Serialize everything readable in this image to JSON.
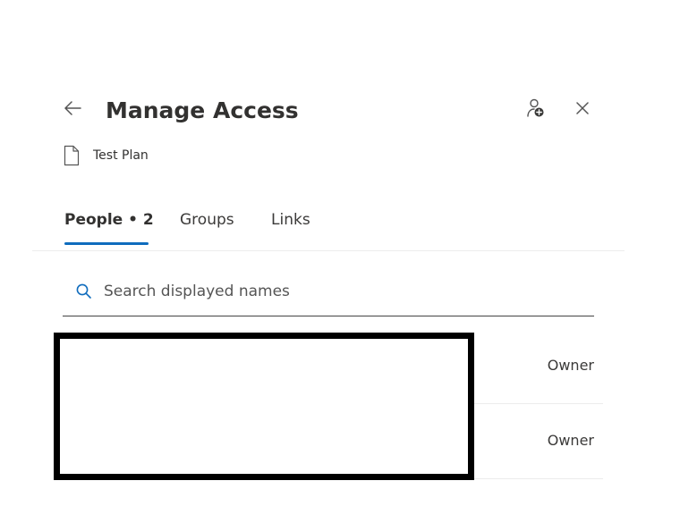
{
  "header": {
    "title": "Manage Access",
    "back_icon": "arrow-left-icon",
    "share_icon": "add-person-icon",
    "close_icon": "close-icon"
  },
  "file": {
    "icon": "document-icon",
    "name": "Test Plan"
  },
  "tabs": [
    {
      "label": "People • 2",
      "selected": true
    },
    {
      "label": "Groups",
      "selected": false
    },
    {
      "label": "Links",
      "selected": false
    }
  ],
  "search": {
    "placeholder": "Search displayed names",
    "value": "",
    "icon": "search-icon"
  },
  "people": [
    {
      "role": "Owner"
    },
    {
      "role": "Owner"
    }
  ],
  "colors": {
    "accent": "#0f6cbd",
    "text": "#323130",
    "divider": "#ececec",
    "redaction_border": "#000000"
  }
}
